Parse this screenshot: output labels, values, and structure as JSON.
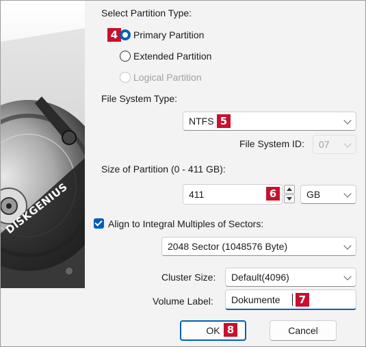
{
  "banner": {
    "brand": "DISKGENIUS"
  },
  "partition_type": {
    "heading": "Select Partition Type:",
    "options": [
      {
        "label": "Primary Partition",
        "checked": true,
        "enabled": true
      },
      {
        "label": "Extended Partition",
        "checked": false,
        "enabled": true
      },
      {
        "label": "Logical Partition",
        "checked": false,
        "enabled": false
      }
    ]
  },
  "file_system": {
    "heading": "File System Type:",
    "value": "NTFS",
    "id_label": "File System ID:",
    "id_value": "07"
  },
  "size": {
    "heading": "Size of Partition (0 - 411 GB):",
    "value": "411",
    "unit": "GB"
  },
  "align": {
    "label": "Align to Integral Multiples of Sectors:",
    "checked": true,
    "sector_value": "2048 Sector (1048576 Byte)"
  },
  "cluster": {
    "label": "Cluster Size:",
    "value": "Default(4096)"
  },
  "volume": {
    "label": "Volume Label:",
    "value": "Dokumente"
  },
  "buttons": {
    "ok": "OK",
    "cancel": "Cancel"
  },
  "annotations": {
    "a4": "4",
    "a5": "5",
    "a6": "6",
    "a7": "7",
    "a8": "8"
  },
  "colors": {
    "accent": "#005fb8",
    "annotation": "#c8102e"
  }
}
